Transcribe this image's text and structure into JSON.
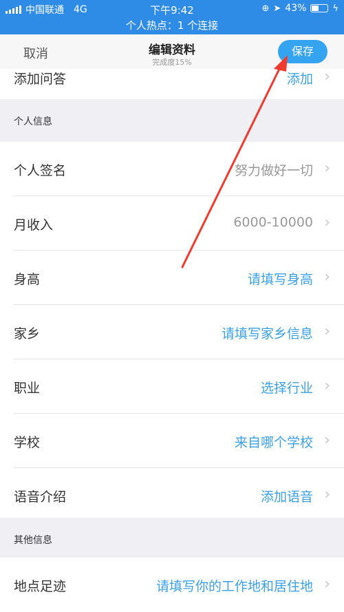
{
  "status": {
    "carrier": "中国联通",
    "network": "4G",
    "time": "下午9:42",
    "battery": "43%",
    "hotspot": "个人热点：1 个连接"
  },
  "nav": {
    "cancel": "取消",
    "title": "编辑资料",
    "subtitle": "完成度15%",
    "save": "保存"
  },
  "partial_row": {
    "label": "添加问答",
    "value": "添加"
  },
  "sections": {
    "personal": "个人信息",
    "other": "其他信息"
  },
  "rows": [
    {
      "label": "个人签名",
      "value": "努力做好一切",
      "style": "gray"
    },
    {
      "label": "月收入",
      "value": "6000-10000",
      "style": "gray"
    },
    {
      "label": "身高",
      "value": "请填写身高",
      "style": "blue"
    },
    {
      "label": "家乡",
      "value": "请填写家乡信息",
      "style": "blue"
    },
    {
      "label": "职业",
      "value": "选择行业",
      "style": "blue"
    },
    {
      "label": "学校",
      "value": "来自哪个学校",
      "style": "blue"
    },
    {
      "label": "语音介绍",
      "value": "添加语音",
      "style": "blue"
    }
  ],
  "other_rows": [
    {
      "label": "地点足迹",
      "value": "请填写你的工作地和居住地",
      "style": "blue"
    }
  ],
  "colors": {
    "accent": "#35a4f0",
    "statusbar": "#2f8ce6",
    "annotation": "#f03a2e"
  }
}
